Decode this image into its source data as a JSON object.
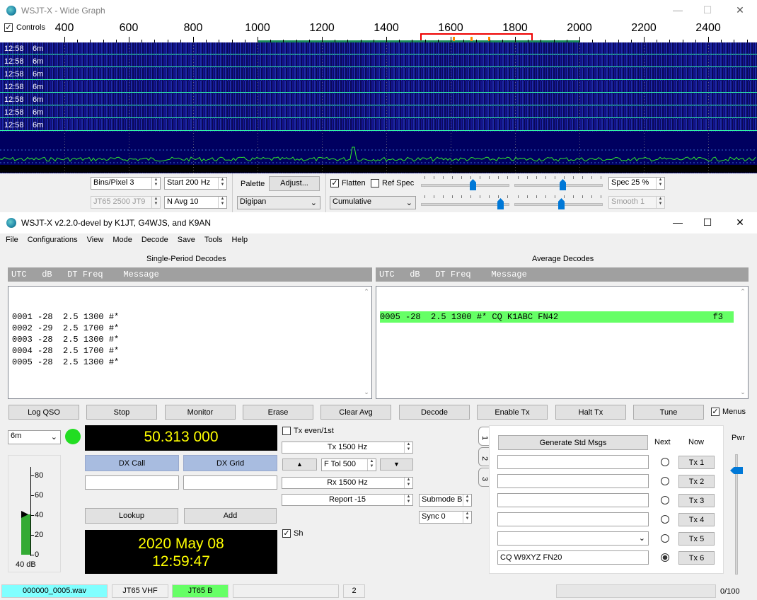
{
  "wide_graph": {
    "title": "WSJT-X - Wide Graph",
    "controls_label": "Controls",
    "axis_ticks": [
      "400",
      "600",
      "800",
      "1000",
      "1200",
      "1400",
      "1600",
      "1800",
      "2000",
      "2200",
      "2400"
    ],
    "waterfall_rows": [
      {
        "time": "12:58",
        "band": "6m"
      },
      {
        "time": "12:58",
        "band": "6m"
      },
      {
        "time": "12:58",
        "band": "6m"
      },
      {
        "time": "12:58",
        "band": "6m"
      },
      {
        "time": "12:58",
        "band": "6m"
      },
      {
        "time": "12:58",
        "band": "6m"
      },
      {
        "time": "12:58",
        "band": "6m"
      }
    ],
    "bins_pixel": "Bins/Pixel  3",
    "start": "Start 200 Hz",
    "jt65_label": "JT65  2500  JT9",
    "navg": "N Avg 10",
    "palette_label": "Palette",
    "adjust_button": "Adjust...",
    "palette_value": "Digipan",
    "flatten_label": "Flatten",
    "ref_spec_label": "Ref Spec",
    "cumulative_value": "Cumulative",
    "spec_value": "Spec 25 %",
    "smooth_value": "Smooth  1",
    "flatten_checked": true,
    "ref_spec_checked": false,
    "controls_checked": true
  },
  "main": {
    "title": "WSJT-X   v2.2.0-devel   by K1JT, G4WJS, and K9AN",
    "menu": [
      "File",
      "Configurations",
      "View",
      "Mode",
      "Decode",
      "Save",
      "Tools",
      "Help"
    ],
    "single_title": "Single-Period Decodes",
    "average_title": "Average Decodes",
    "col_header": "UTC   dB   DT Freq    Message",
    "single_decodes": [
      "0001 -28  2.5 1300 #*",
      "0002 -29  2.5 1700 #*",
      "0003 -28  2.5 1300 #*",
      "0004 -28  2.5 1700 #*",
      "0005 -28  2.5 1300 #*"
    ],
    "average_decode": "0005 -28  2.5 1300 #* CQ K1ABC FN42",
    "average_flag": "f3",
    "buttons": [
      "Log QSO",
      "Stop",
      "Monitor",
      "Erase",
      "Clear Avg",
      "Decode",
      "Enable Tx",
      "Halt Tx",
      "Tune"
    ],
    "menus_label": "Menus",
    "band": "6m",
    "frequency": "50.313 000",
    "tx_even_label": "Tx even/1st",
    "tx_freq": "Tx  1500  Hz",
    "rx_freq": "Rx  1500  Hz",
    "ftol": "F Tol  500",
    "report": "Report -15",
    "submode": "Submode B",
    "sync": "Sync   0",
    "dx_call_label": "DX Call",
    "dx_grid_label": "DX Grid",
    "lookup_button": "Lookup",
    "add_button": "Add",
    "sh_label": "Sh",
    "date": "2020 May 08",
    "time": "12:59:47",
    "meter_ticks": [
      "80",
      "60",
      "40",
      "20",
      "0"
    ],
    "meter_db": "40 dB",
    "tabs": [
      "1",
      "2",
      "3"
    ],
    "gen_std_msgs": "Generate Std Msgs",
    "next_label": "Next",
    "now_label": "Now",
    "tx_buttons": [
      "Tx 1",
      "Tx 2",
      "Tx 3",
      "Tx 4",
      "Tx 5",
      "Tx 6"
    ],
    "tx6_message": "CQ W9XYZ FN20",
    "pwr_label": "Pwr",
    "status": {
      "file": "000000_0005.wav",
      "mode": "JT65 VHF",
      "submode": "JT65 B",
      "count": "2",
      "progress": "0/100"
    },
    "colors": {
      "green_led": "#22dd22",
      "avg_highlight": "#66ff66",
      "status_file": "#80ffff",
      "status_submode": "#66ff66"
    }
  }
}
